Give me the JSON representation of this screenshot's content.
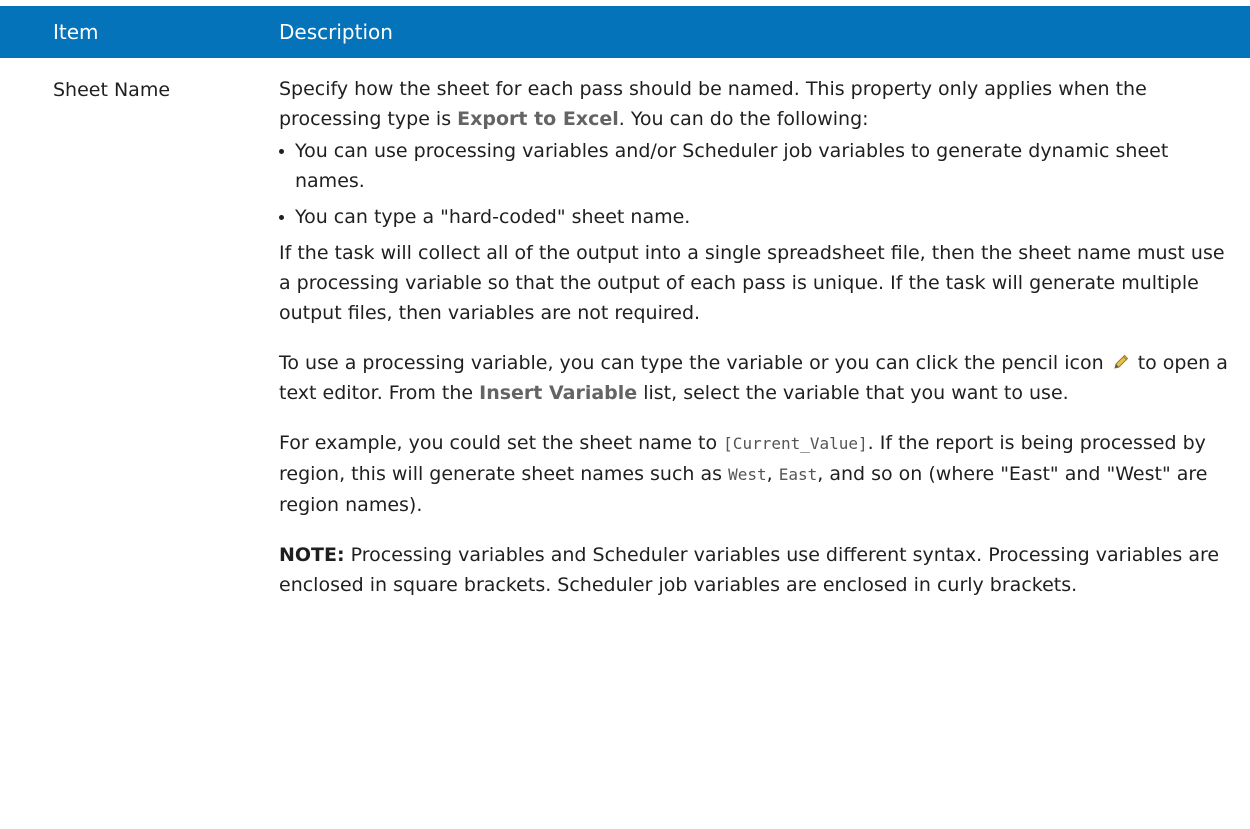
{
  "header": {
    "item": "Item",
    "description": "Description"
  },
  "row": {
    "item": "Sheet Name",
    "intro_1": "Specify how the sheet for each pass should be named. This property only applies when the processing type is ",
    "intro_term": "Export to Excel",
    "intro_2": ". You can do the following:",
    "bullets": [
      "You can use processing variables and/or Scheduler job variables to generate dynamic sheet names.",
      "You can type a \"hard-coded\" sheet name."
    ],
    "para_collect": "If the task will collect all of the output into a single spreadsheet file, then the sheet name must use a processing variable so that the output of each pass is unique. If the task will generate multiple output files, then variables are not required.",
    "pencil_1": "To use a processing variable, you can type the variable or you can click the pencil icon ",
    "pencil_2": " to open a text editor. From the ",
    "pencil_term": "Insert Variable",
    "pencil_3": " list, select the variable that you want to use.",
    "example_1": "For example, you could set the sheet name to ",
    "example_code_1": "[Current_Value]",
    "example_2": ". If the report is being processed by region, this will generate sheet names such as ",
    "example_code_2": "West",
    "example_3": ", ",
    "example_code_3": "East",
    "example_4": ", and so on (where \"East\" and \"West\" are region names).",
    "note_label": "NOTE:",
    "note_text": " Processing variables and Scheduler variables use different syntax. Processing variables are enclosed in square brackets. Scheduler job variables are enclosed in curly brackets."
  },
  "colors": {
    "header_bg": "#0473b9",
    "ui_term": "#646464"
  },
  "icons": {
    "pencil": "pencil-icon"
  }
}
